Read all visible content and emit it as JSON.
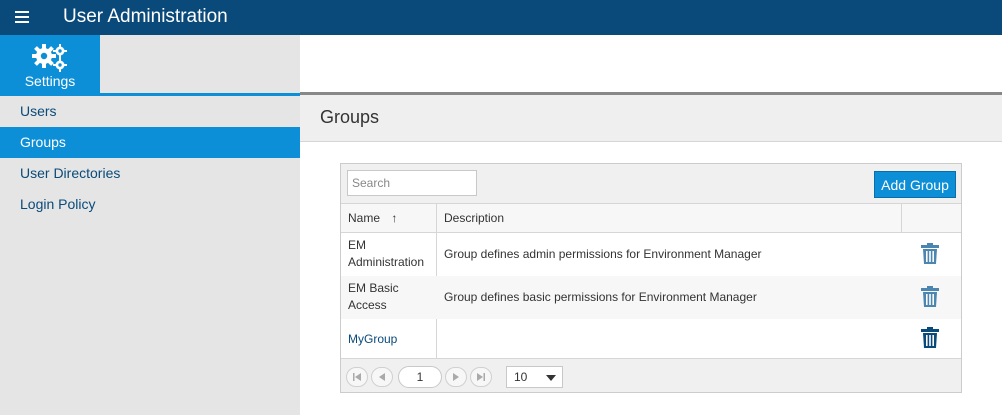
{
  "header": {
    "app_title": "User Administration",
    "menu_icon": "hamburger-icon"
  },
  "tabs": {
    "settings_label": "Settings",
    "settings_icon": "gears-icon"
  },
  "sidebar": {
    "items": [
      {
        "label": "Users",
        "active": false
      },
      {
        "label": "Groups",
        "active": true
      },
      {
        "label": "User Directories",
        "active": false
      },
      {
        "label": "Login Policy",
        "active": false
      }
    ]
  },
  "page": {
    "title": "Groups"
  },
  "toolbar": {
    "search_placeholder": "Search",
    "add_group_label": "Add Group"
  },
  "table": {
    "columns": {
      "name": "Name",
      "sort_indicator": "↑",
      "description": "Description"
    },
    "rows": [
      {
        "name_line1": "EM",
        "name_line2": "Administration",
        "description": "Group defines admin permissions for Environment Manager",
        "delete_icon": "trash-icon"
      },
      {
        "name_line1": "EM Basic",
        "name_line2": "Access",
        "description": "Group defines basic permissions for Environment Manager",
        "delete_icon": "trash-icon"
      },
      {
        "name_line1": "MyGroup",
        "name_line2": "",
        "description": "",
        "delete_icon": "trash-icon"
      }
    ]
  },
  "pager": {
    "current_page": "1",
    "page_size": "10"
  },
  "colors": {
    "topbar": "#0a4a7a",
    "accent": "#0c8fd6",
    "sidebar_bg": "#e5e5e5",
    "icon_muted": "#4a86b0",
    "icon_dark": "#0a4a7a"
  }
}
